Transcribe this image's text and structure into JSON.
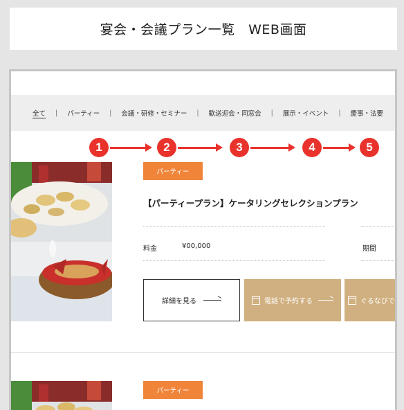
{
  "page_title": "宴会・会議プラン一覧　WEB画面",
  "nav": {
    "items": [
      {
        "label": "全て",
        "active": true
      },
      {
        "label": "パーティー",
        "active": false
      },
      {
        "label": "会議・研修・セミナー",
        "active": false
      },
      {
        "label": "歓送迎会・同窓会",
        "active": false
      },
      {
        "label": "展示・イベント",
        "active": false
      },
      {
        "label": "慶事・法要",
        "active": false
      }
    ],
    "separator": "|"
  },
  "steps": [
    "1",
    "2",
    "3",
    "4",
    "5"
  ],
  "colors": {
    "step_red": "#e8322b",
    "badge_orange": "#f0853a",
    "button_tan": "#d0b080"
  },
  "plans": [
    {
      "badge": "パーティー",
      "title": "【パーティープラン】ケータリングセレクションプラン",
      "price_label": "料金",
      "price_value": "¥00,000",
      "period_label": "期間",
      "buttons": {
        "detail": "詳細を見る",
        "tel": "電話で予約する",
        "gnavi": "ぐるなびで"
      }
    },
    {
      "badge": "パーティー"
    }
  ]
}
